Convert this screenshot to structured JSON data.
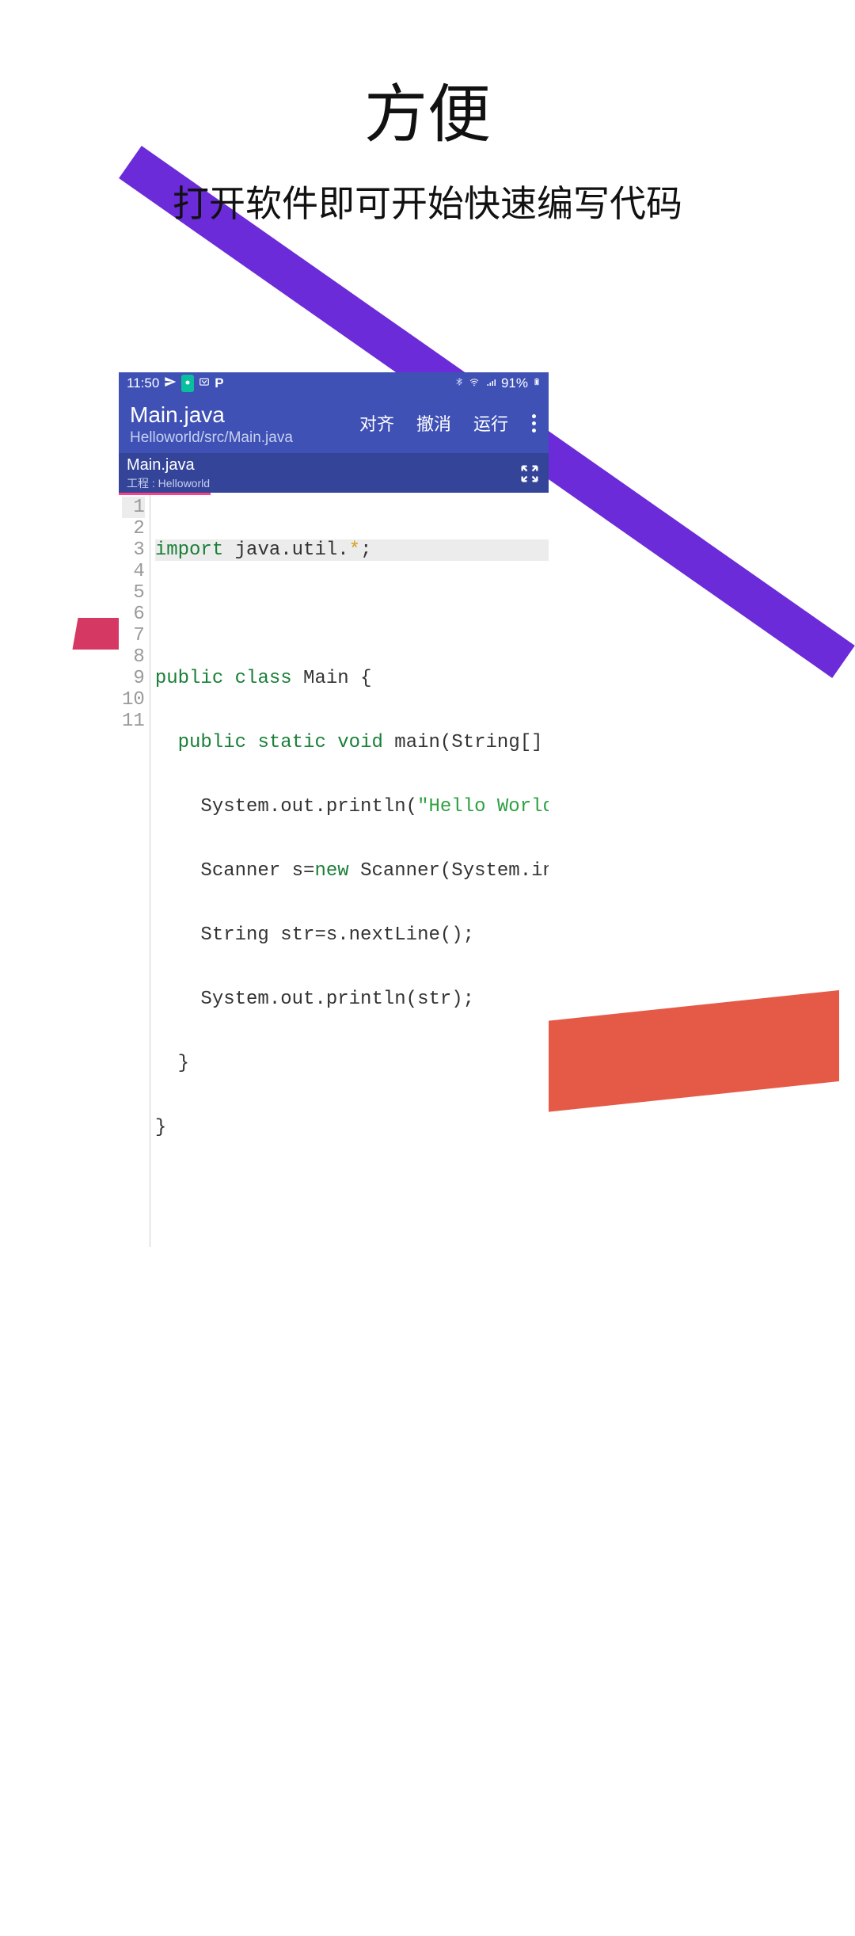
{
  "page": {
    "title": "方便",
    "subtitle": "打开软件即可开始快速编写代码"
  },
  "statusbar": {
    "time": "11:50",
    "battery": "91%"
  },
  "header": {
    "title": "Main.java",
    "path": "Helloworld/src/Main.java",
    "actions": {
      "align": "对齐",
      "undo": "撤消",
      "run": "运行"
    }
  },
  "tab": {
    "name": "Main.java",
    "project_prefix": "工程 : ",
    "project_name": "Helloworld"
  },
  "gutter": [
    "1",
    "2",
    "3",
    "4",
    "5",
    "6",
    "7",
    "8",
    "9",
    "10",
    "11"
  ],
  "code": {
    "l1_import": "import",
    "l1_pkg": " java.util.",
    "l1_star": "*",
    "l1_semi": ";",
    "l3_public": "public",
    "l3_class": " class",
    "l3_rest": " Main {",
    "l4_indent": "  ",
    "l4_public": "public",
    "l4_static": " static",
    "l4_void": " void",
    "l4_rest": " main(String[]",
    "l5_indent": "    ",
    "l5_text": "System.out.println(",
    "l5_str": "\"Hello World",
    "l6_indent": "    ",
    "l6_a": "Scanner s=",
    "l6_new": "new",
    "l6_b": " Scanner(System.in",
    "l7_indent": "    ",
    "l7_text": "String str=s.nextLine();",
    "l8_indent": "    ",
    "l8_text": "System.out.println(str);",
    "l9_indent": "  ",
    "l9_brace": "}",
    "l10_brace": "}"
  }
}
